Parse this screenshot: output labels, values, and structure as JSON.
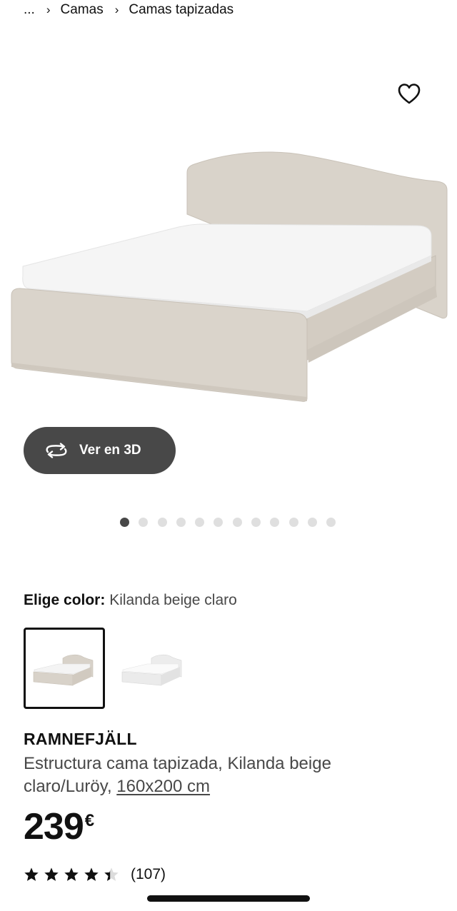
{
  "breadcrumb": {
    "ellipsis": "...",
    "items": [
      "Camas",
      "Camas tapizadas"
    ]
  },
  "gallery": {
    "view_3d_label": "Ver en 3D",
    "image_count": 12,
    "active_index": 0
  },
  "color": {
    "label": "Elige color:",
    "value": "Kilanda beige claro",
    "options": [
      "Kilanda beige claro",
      "white"
    ]
  },
  "product": {
    "name": "RAMNEFJÄLL",
    "description": "Estructura cama tapizada, Kilanda beige claro/Luröy,",
    "size": "160x200 cm",
    "price": "239",
    "currency": "€"
  },
  "rating": {
    "value": 4.4,
    "max": 5,
    "count": "(107)"
  },
  "colors": {
    "text": "#111111",
    "muted": "#484848",
    "button_bg": "#484848",
    "dot_inactive": "#dfdfdf",
    "fabric_beige": "#d8d2c9",
    "mattress": "#f4f4f4"
  },
  "icons": {
    "wishlist": "heart-outline-icon",
    "view_3d": "rotate-arrows-icon",
    "breadcrumb_sep": "chevron-right-icon",
    "rating": "star-icon"
  }
}
